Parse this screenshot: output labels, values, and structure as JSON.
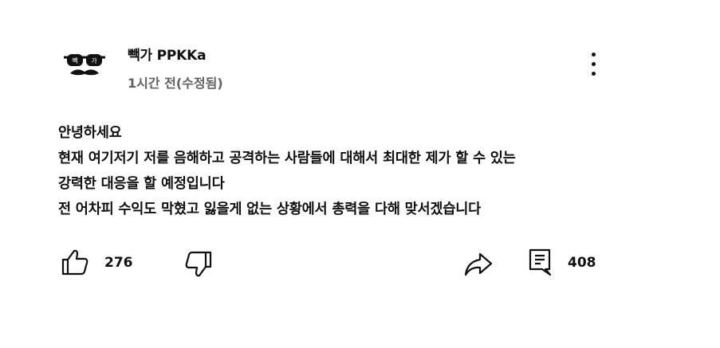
{
  "comment": {
    "author": "빽가 PPKKa",
    "avatar_badge_text": [
      "빽",
      "가"
    ],
    "time": "1시간 전(수정됨)",
    "body_lines": [
      "안녕하세요",
      "현재 여기저기 저를 음해하고 공격하는 사람들에 대해서 최대한 제가 할 수 있는",
      "강력한 대응을 할 예정입니다",
      "전 어차피 수익도 막혔고  잃을게 없는 상황에서 총력을 다해 맞서겠습니다"
    ]
  },
  "actions": {
    "like_count": "276",
    "reply_count": "408",
    "icons": [
      "thumbs-up-icon",
      "thumbs-down-icon",
      "share-icon",
      "reply-icon",
      "more-vertical-icon"
    ]
  }
}
